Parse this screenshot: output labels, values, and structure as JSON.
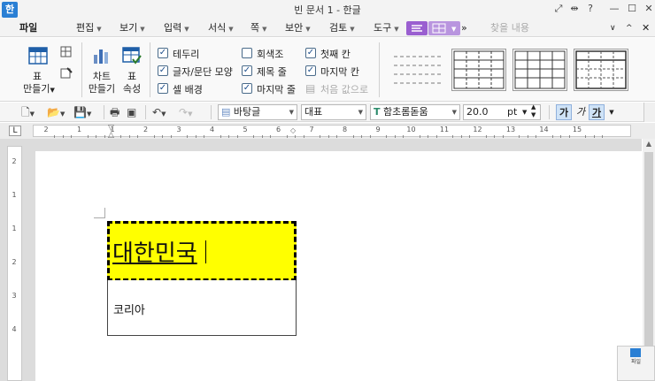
{
  "window": {
    "app_icon_glyph": "한",
    "title": "빈 문서 1 - 한글",
    "buttons": [
      "⤢",
      "⇹",
      "?",
      "—",
      "☐",
      "✕"
    ]
  },
  "menu": {
    "items": [
      "파일",
      "편집",
      "보기",
      "입력",
      "서식",
      "쪽",
      "보안",
      "검토",
      "도구"
    ],
    "search_placeholder": "찾을 내용",
    "more_glyph": "»",
    "collapse_glyph": "^",
    "close_glyph": "✕"
  },
  "ribbon": {
    "table_create_label_1": "표",
    "table_create_label_2": "만들기",
    "chart_label_1": "차트",
    "chart_label_2": "만들기",
    "table_props_label_1": "표",
    "table_props_label_2": "속성",
    "checks": [
      {
        "label": "테두리",
        "checked": true
      },
      {
        "label": "글자/문단 모양",
        "checked": true
      },
      {
        "label": "셀 배경",
        "checked": true
      },
      {
        "label": "회색조",
        "checked": false
      },
      {
        "label": "제목 줄",
        "checked": true
      },
      {
        "label": "마지막 줄",
        "checked": true
      },
      {
        "label": "첫째 칸",
        "checked": true
      },
      {
        "label": "마지막 칸",
        "checked": true
      }
    ],
    "reset_label": "처음 값으로"
  },
  "toolbar": {
    "style_value": "바탕글",
    "lang_value": "대표",
    "font_value": "함초롬돋움",
    "size_value": "20.0",
    "size_unit": "pt",
    "fmt_buttons": [
      "가",
      "가",
      "가"
    ]
  },
  "ruler": {
    "h_numbers": [
      "2",
      "1",
      "1",
      "2",
      "3",
      "4",
      "5",
      "6",
      "7",
      "8",
      "9",
      "10",
      "11",
      "12",
      "13",
      "14",
      "15"
    ],
    "v_numbers": [
      "2",
      "1",
      "1",
      "2",
      "3",
      "4"
    ]
  },
  "document": {
    "heading": "대한민국",
    "body": "코리아"
  },
  "colors": {
    "accent_purple": "#9a5fd0",
    "cell_highlight": "#ffff00",
    "checkbox_tick": "#1f4f8c"
  }
}
